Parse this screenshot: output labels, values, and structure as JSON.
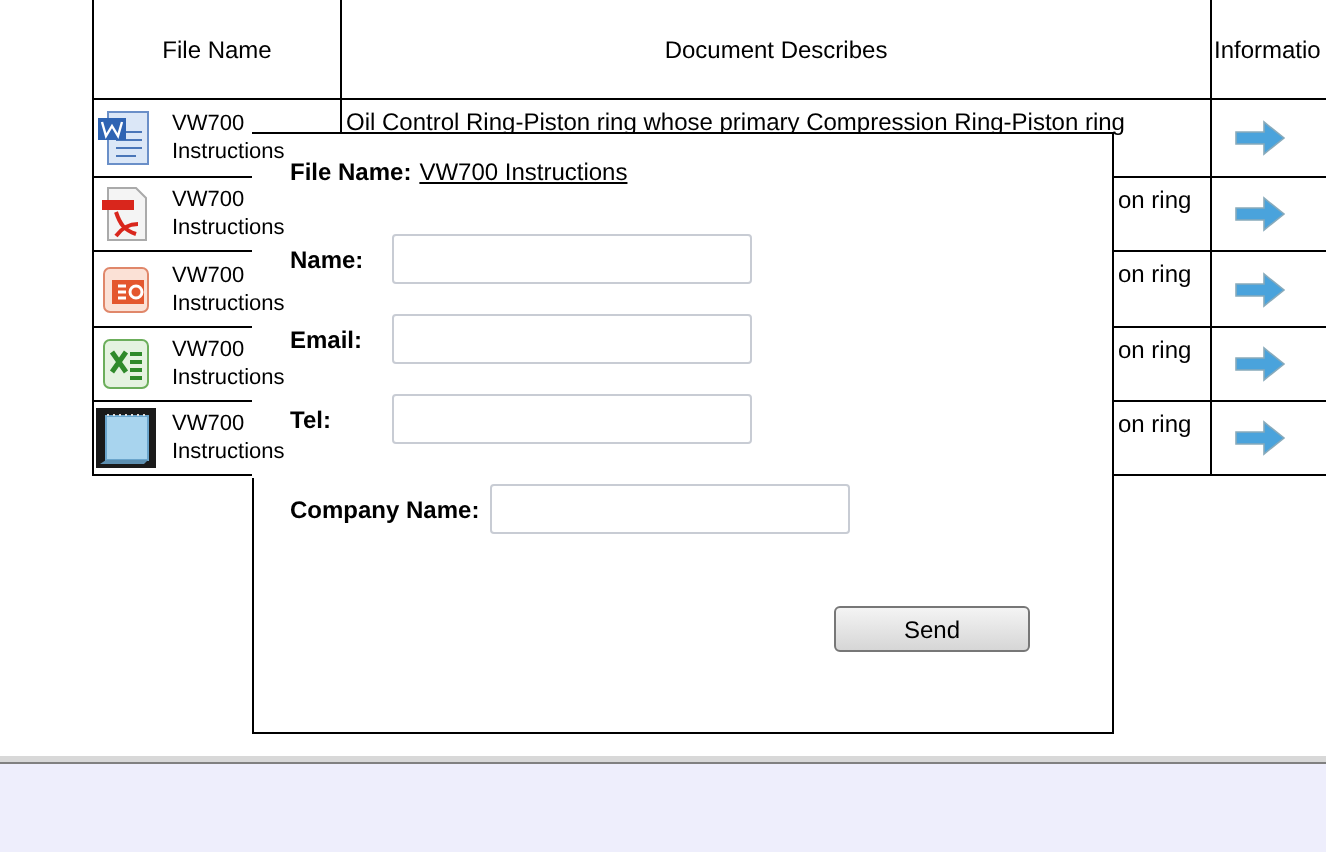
{
  "table": {
    "columns": [
      "File Name",
      "Document Describes",
      "Informatio"
    ],
    "rows": [
      {
        "kind": "word",
        "name": "VW700 Instructions",
        "description": "Oil Control Ring-Piston ring whose primary Compression Ring-Piston ring"
      },
      {
        "kind": "pdf",
        "name": "VW700 Instructions",
        "description": "on ring"
      },
      {
        "kind": "slides",
        "name": "VW700 Instructions",
        "description": "on ring"
      },
      {
        "kind": "sheet",
        "name": "VW700 Instructions",
        "description": "on ring"
      },
      {
        "kind": "notepad",
        "name": "VW700 Instructions",
        "description": "on ring"
      }
    ]
  },
  "dialog": {
    "file_label": "File Name:",
    "file_link": "VW700 Instructions",
    "fields": [
      {
        "label": "Name:"
      },
      {
        "label": "Email:"
      },
      {
        "label": "Tel:"
      },
      {
        "label": "Company Name:"
      }
    ],
    "button": "Send"
  }
}
